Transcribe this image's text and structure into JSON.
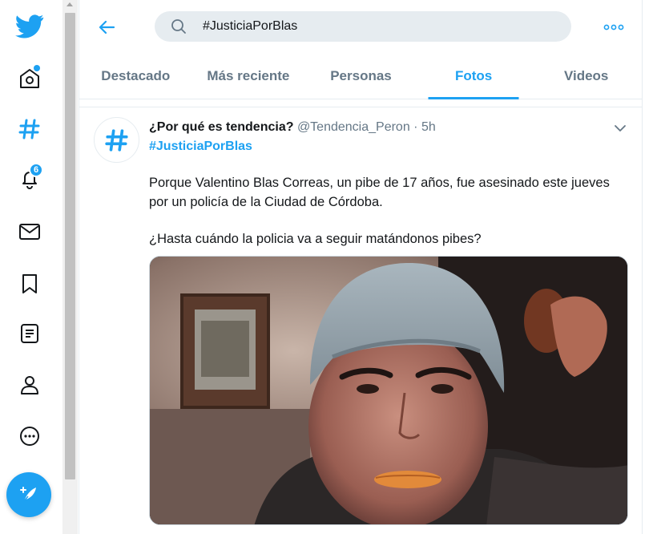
{
  "colors": {
    "accent": "#1da1f2",
    "text_primary": "#14171a",
    "text_secondary": "#657786",
    "border": "#e6ecf0",
    "search_bg": "#e6ecf0"
  },
  "nav": {
    "items": [
      {
        "name": "twitter-logo-icon"
      },
      {
        "name": "home-icon"
      },
      {
        "name": "explore-hashtag-icon"
      },
      {
        "name": "notifications-bell-icon"
      },
      {
        "name": "messages-envelope-icon"
      },
      {
        "name": "bookmark-icon"
      },
      {
        "name": "lists-icon"
      },
      {
        "name": "profile-icon"
      },
      {
        "name": "more-circle-icon"
      }
    ],
    "notifications_badge": "6",
    "compose_icon": "feather-plus-icon"
  },
  "header": {
    "back_icon": "arrow-left-icon",
    "search_value": "#JusticiaPorBlas",
    "more_icon": "ellipsis-icon"
  },
  "tabs": [
    {
      "label": "Destacado",
      "active": false
    },
    {
      "label": "Más reciente",
      "active": false
    },
    {
      "label": "Personas",
      "active": false
    },
    {
      "label": "Fotos",
      "active": true
    },
    {
      "label": "Videos",
      "active": false
    }
  ],
  "tweet": {
    "avatar_icon": "hashtag-icon",
    "name": "¿Por qué es tendencia?",
    "handle": "@Tendencia_Peron",
    "separator": " · ",
    "time": "5h",
    "hashtag": "#JusticiaPorBlas",
    "text_1": "Porque Valentino Blas Correas, un pibe de 17 años, fue asesinado este jueves por un policía de la Ciudad de Córdoba.",
    "text_2": "¿Hasta cuándo la policia va a seguir matándonos pibes?",
    "media": "photo"
  }
}
